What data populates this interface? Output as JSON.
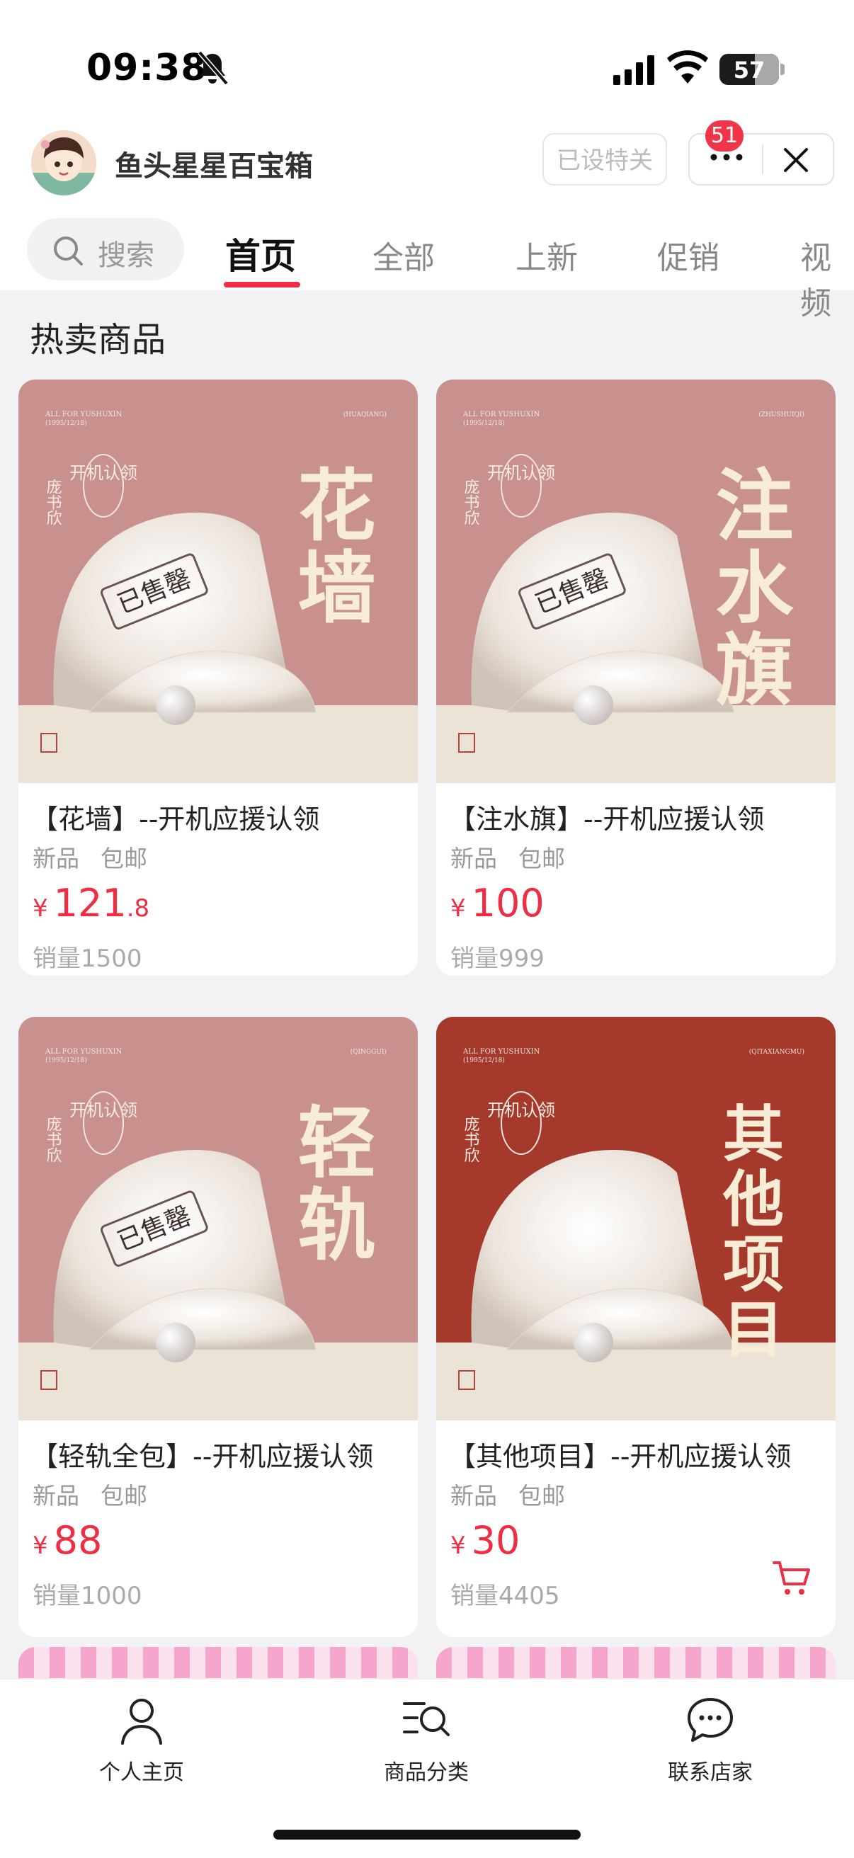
{
  "status_bar": {
    "time": "09:38",
    "battery": "57",
    "battery_level": 0.57
  },
  "header": {
    "shop_name": "鱼头星星百宝箱",
    "follow_label": "已设特关",
    "more_badge": "51",
    "icons": [
      "bell-mute-icon",
      "signal-icon",
      "wifi-icon",
      "more-icon",
      "close-icon",
      "search-icon"
    ]
  },
  "search": {
    "placeholder": "搜索"
  },
  "tabs": [
    {
      "label": "首页"
    },
    {
      "label": "全部"
    },
    {
      "label": "上新"
    },
    {
      "label": "促销"
    },
    {
      "label": "视频"
    }
  ],
  "section_title": "热卖商品",
  "products": [
    {
      "title": "【花墙】--开机应援认领",
      "tags": [
        "新品",
        "包邮"
      ],
      "currency": "¥",
      "price_int": "121",
      "price_dec": ".8",
      "sales": "销量1500",
      "art": {
        "brand": "ALL FOR YUSHUXIN",
        "date": "(1995/12/18)",
        "code": "(HUAQIANG)",
        "side": "开机认领",
        "name": "庞书欣",
        "big": "花墙",
        "stamp": "已售罄"
      },
      "theme": "#c8918e"
    },
    {
      "title": "【注水旗】--开机应援认领",
      "tags": [
        "新品",
        "包邮"
      ],
      "currency": "¥",
      "price_int": "100",
      "price_dec": "",
      "sales": "销量999",
      "art": {
        "brand": "ALL FOR YUSHUXIN",
        "date": "(1995/12/18)",
        "code": "(ZHUSHUIQI)",
        "side": "开机认领",
        "name": "庞书欣",
        "big": "注水旗",
        "stamp": "已售罄"
      },
      "theme": "#c8918e"
    },
    {
      "title": "【轻轨全包】--开机应援认领",
      "tags": [
        "新品",
        "包邮"
      ],
      "currency": "¥",
      "price_int": "88",
      "price_dec": "",
      "sales": "销量1000",
      "art": {
        "brand": "ALL FOR YUSHUXIN",
        "date": "(1995/12/18)",
        "code": "(QINGGUI)",
        "side": "开机认领",
        "name": "庞书欣",
        "big": "轻轨",
        "stamp": "已售罄"
      },
      "theme": "#c8918e"
    },
    {
      "title": "【其他项目】--开机应援认领",
      "tags": [
        "新品",
        "包邮"
      ],
      "currency": "¥",
      "price_int": "30",
      "price_dec": "",
      "sales": "销量4405",
      "art": {
        "brand": "ALL FOR YUSHUXIN",
        "date": "(1995/12/18)",
        "code": "(QITAXIANGMU)",
        "side": "开机认领",
        "name": "庞书欣",
        "big": "其他项目",
        "stamp": ""
      },
      "theme": "#a53a2c"
    }
  ],
  "bottom_nav": [
    {
      "label": "个人主页"
    },
    {
      "label": "商品分类"
    },
    {
      "label": "联系店家"
    }
  ]
}
